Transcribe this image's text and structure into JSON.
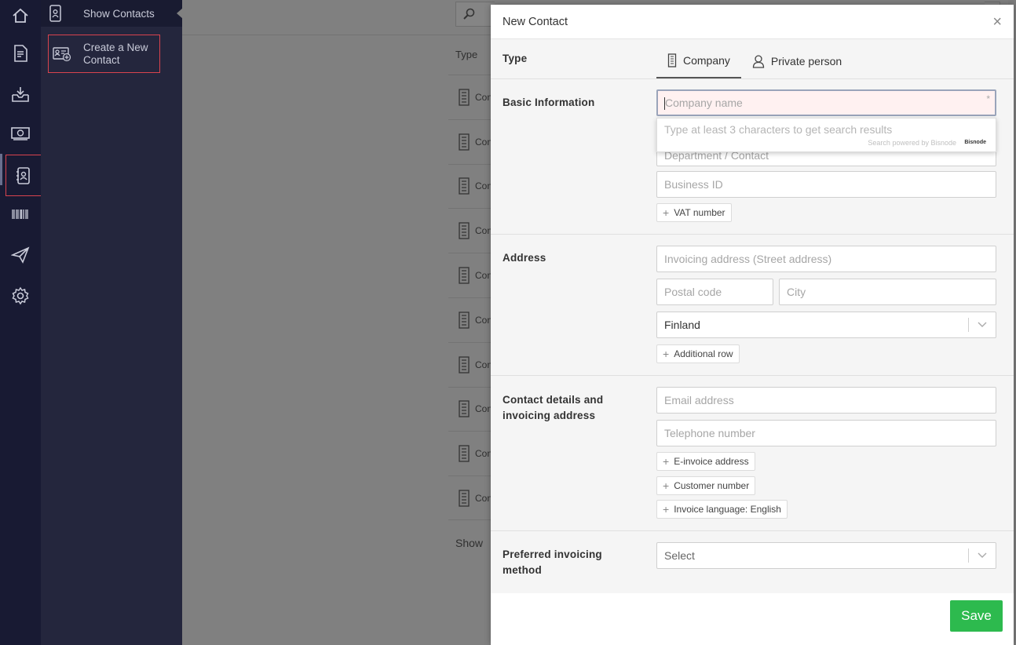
{
  "rail": {
    "icons": [
      "home-icon",
      "invoice-icon",
      "inbox-icon",
      "money-icon",
      "contacts-icon",
      "barcode-icon",
      "send-icon",
      "settings-icon"
    ]
  },
  "submenu": {
    "show_contacts": "Show Contacts",
    "create_contact": "Create a New Contact"
  },
  "background": {
    "type_header": "Type",
    "row_text": "Con",
    "show_label": "Show"
  },
  "modal": {
    "title": "New Contact",
    "close": "×",
    "type": {
      "label": "Type",
      "tabs": [
        {
          "label": "Company",
          "active": true,
          "icon": "building-icon"
        },
        {
          "label": "Private person",
          "active": false,
          "icon": "person-icon"
        }
      ]
    },
    "basic": {
      "label": "Basic Information",
      "company_placeholder": "Company name",
      "required_mark": "*",
      "dropdown_hint": "Type at least 3 characters to get search results",
      "powered_by": "Search powered by Bisnode",
      "bisnode_logo": "Bisnode",
      "department_placeholder": "Department / Contact",
      "business_id_placeholder": "Business ID",
      "vat_chip": "VAT number"
    },
    "address": {
      "label": "Address",
      "street_placeholder": "Invoicing address (Street address)",
      "postal_placeholder": "Postal code",
      "city_placeholder": "City",
      "country_value": "Finland",
      "additional_chip": "Additional row"
    },
    "contact": {
      "label": "Contact details and invoicing address",
      "email_placeholder": "Email address",
      "phone_placeholder": "Telephone number",
      "chips": [
        "E-invoice address",
        "Customer number",
        "Invoice language: English"
      ]
    },
    "preferred": {
      "label": "Preferred invoicing method",
      "select_value": "Select"
    },
    "save": "Save"
  },
  "colors": {
    "rail_bg": "#181a33",
    "submenu_bg": "#24263d",
    "highlight_border": "#d9434e",
    "save_bg": "#2dba4e"
  }
}
